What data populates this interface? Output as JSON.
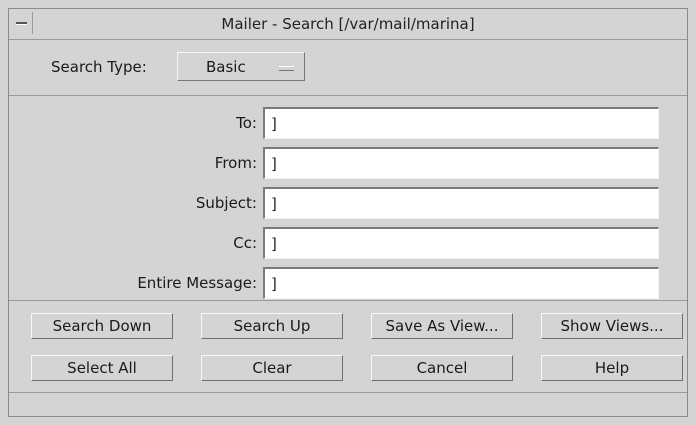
{
  "window": {
    "title": "Mailer - Search [/var/mail/marina]"
  },
  "search_type": {
    "label": "Search Type:",
    "value": "Basic"
  },
  "fields": [
    {
      "label": "To:",
      "value": "]"
    },
    {
      "label": "From:",
      "value": "]"
    },
    {
      "label": "Subject:",
      "value": "]"
    },
    {
      "label": "Cc:",
      "value": "]"
    },
    {
      "label": "Entire Message:",
      "value": "]"
    }
  ],
  "buttons": {
    "search_down": "Search Down",
    "search_up": "Search Up",
    "save_as_view": "Save As View...",
    "show_views": "Show Views...",
    "select_all": "Select All",
    "clear": "Clear",
    "cancel": "Cancel",
    "help": "Help"
  },
  "icons": {
    "window_menu": "window-menu-icon",
    "dropdown_indicator": "option-menu-indicator-icon"
  }
}
